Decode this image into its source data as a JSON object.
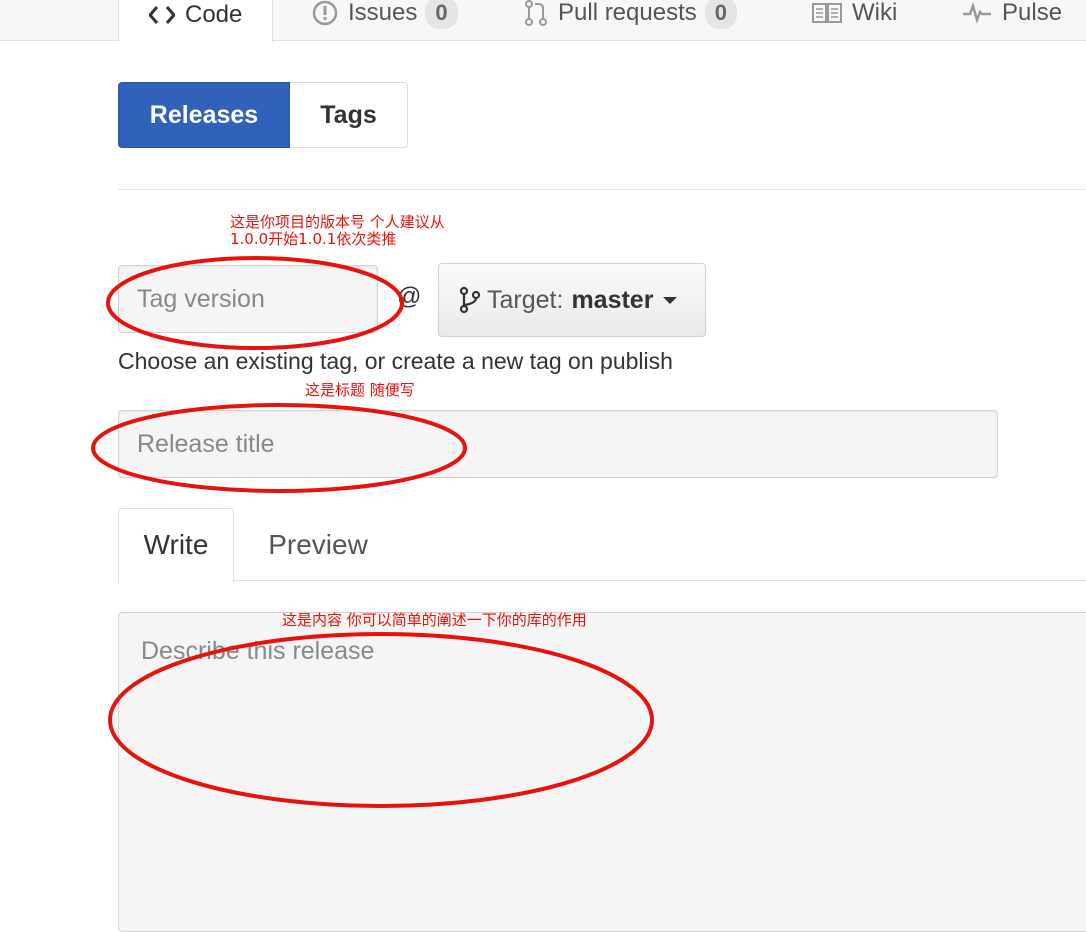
{
  "repo_nav": {
    "tabs": [
      {
        "label": "Code",
        "icon": "code-icon",
        "selected": true
      },
      {
        "label": "Issues",
        "icon": "issue-icon",
        "count": "0"
      },
      {
        "label": "Pull requests",
        "icon": "pull-request-icon",
        "count": "0"
      },
      {
        "label": "Wiki",
        "icon": "book-icon"
      },
      {
        "label": "Pulse",
        "icon": "pulse-icon"
      }
    ]
  },
  "subnav": {
    "releases": "Releases",
    "tags": "Tags",
    "active": "Releases"
  },
  "form": {
    "tag_placeholder": "Tag version",
    "at_symbol": "@",
    "target_label": "Target:",
    "target_branch": "master",
    "tag_hint": "Choose an existing tag, or create a new tag on publish",
    "title_placeholder": "Release title",
    "write_tab": "Write",
    "preview_tab": "Preview",
    "body_placeholder": "Describe this release"
  },
  "annotations": {
    "tag_note_line1": "这是你项目的版本号 个人建议从",
    "tag_note_line2": "1.0.0开始1.0.1依次类推",
    "title_note": "这是标题 随便写",
    "body_note": "这是内容 你可以简单的阐述一下你的库的作用",
    "color": "#e8120c"
  },
  "colors": {
    "primary": "#2f62b8",
    "annotation": "#e8120c"
  }
}
